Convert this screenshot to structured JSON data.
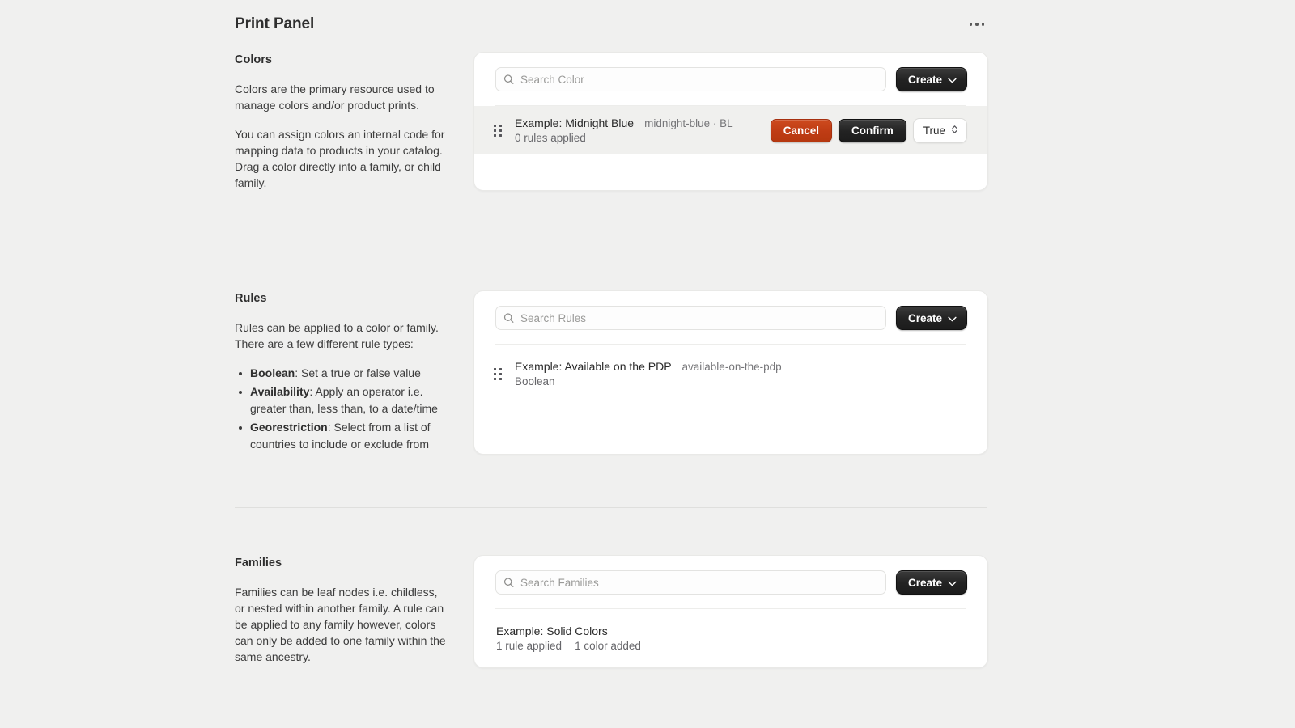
{
  "header": {
    "title": "Print Panel",
    "menu_icon": "kebab-menu-icon"
  },
  "sections": [
    {
      "key": "colors",
      "title": "Colors",
      "paragraphs": [
        "Colors are the primary resource used to manage colors and/or product prints.",
        "You can assign colors an internal code for mapping data to products in your catalog. Drag a color directly into a family, or child family."
      ],
      "search_placeholder": "Search Color",
      "search_value": "",
      "create_label": "Create",
      "row": {
        "name": "Example: Midnight Blue",
        "meta": "midnight-blue · BL",
        "sub": "0 rules applied",
        "cancel_label": "Cancel",
        "confirm_label": "Confirm",
        "select_value": "True"
      }
    },
    {
      "key": "rules",
      "title": "Rules",
      "paragraphs": [
        "Rules can be applied to a color or family. There are a few different rule types:"
      ],
      "bullets": [
        {
          "term": "Boolean",
          "text": ": Set a true or false value"
        },
        {
          "term": "Availability",
          "text": ": Apply an operator i.e. greater than, less than, to a date/time"
        },
        {
          "term": "Georestriction",
          "text": ": Select from a list of countries to include or exclude from"
        }
      ],
      "search_placeholder": "Search Rules",
      "search_value": "",
      "create_label": "Create",
      "row": {
        "name": "Example: Available on the PDP",
        "meta": "available-on-the-pdp",
        "sub": "Boolean"
      }
    },
    {
      "key": "families",
      "title": "Families",
      "paragraphs": [
        "Families can be leaf nodes i.e. childless, or nested within another family. A rule can be applied to any family however, colors can only be added to one family within the same ancestry."
      ],
      "search_placeholder": "Search Families",
      "search_value": "",
      "create_label": "Create",
      "row": {
        "name": "Example: Solid Colors",
        "sub_rules": "1 rule applied",
        "sub_colors": "1 color added"
      }
    }
  ],
  "colors": {
    "page_background": "#F0F0EF",
    "card_background": "#FFFFFF",
    "selected_row": "#F0F0EE",
    "primary_button": "#232323",
    "danger_button": "#BF3C14",
    "text": "#2F2F2F",
    "muted_text": "#77777A"
  }
}
